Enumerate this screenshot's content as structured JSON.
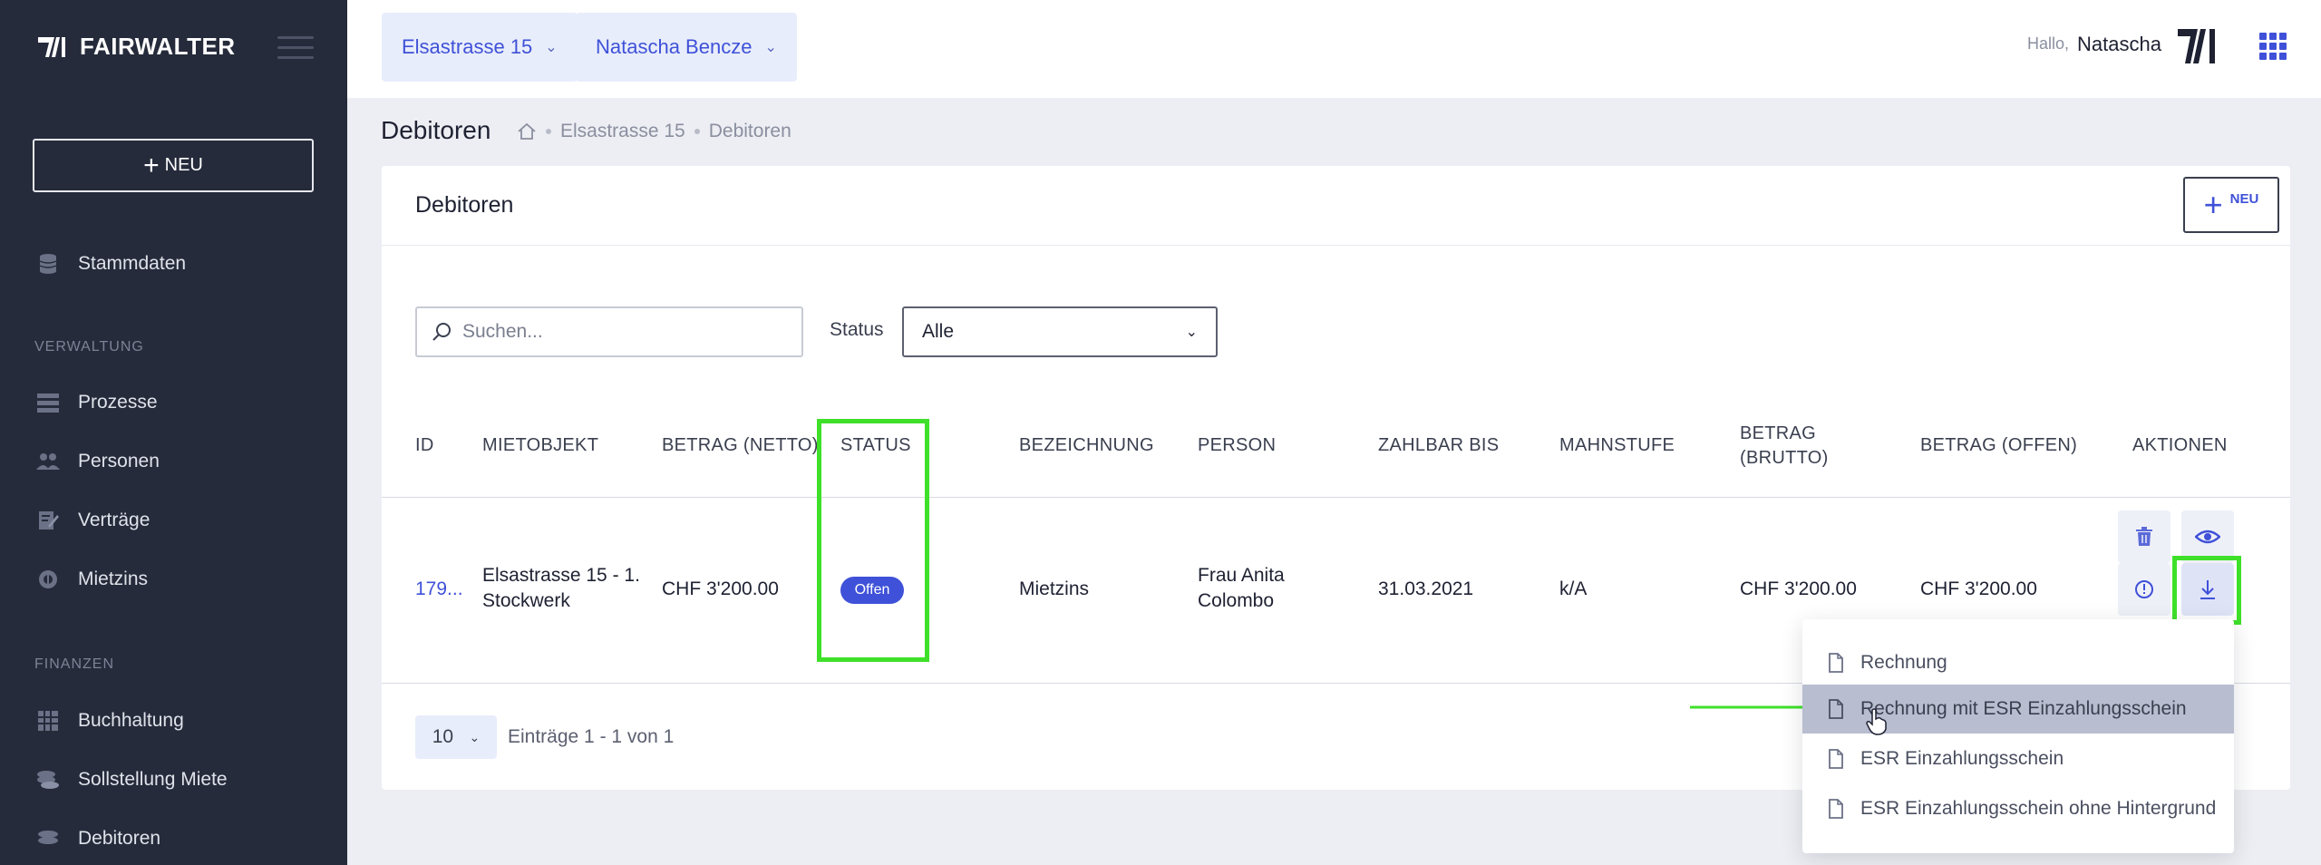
{
  "brand": "FAIRWALTER",
  "sidebar": {
    "new_label": "NEU",
    "items_top": [
      {
        "label": "Stammdaten",
        "icon": "database-icon"
      }
    ],
    "section_verwaltung": "VERWALTUNG",
    "items_verwaltung": [
      {
        "label": "Prozesse",
        "icon": "list-icon"
      },
      {
        "label": "Personen",
        "icon": "people-icon"
      },
      {
        "label": "Verträge",
        "icon": "contract-icon"
      },
      {
        "label": "Mietzins",
        "icon": "rent-icon"
      }
    ],
    "section_finanzen": "FINANZEN",
    "items_finanzen": [
      {
        "label": "Buchhaltung",
        "icon": "ledger-icon"
      },
      {
        "label": "Sollstellung Miete",
        "icon": "coins-icon"
      },
      {
        "label": "Debitoren",
        "icon": "debtor-icon"
      }
    ]
  },
  "topbar": {
    "property": "Elsastrasse 15",
    "person": "Natascha Bencze",
    "hello": "Hallo,",
    "user_name": "Natascha"
  },
  "page": {
    "title": "Debitoren",
    "breadcrumb": [
      "Elsastrasse 15",
      "Debitoren"
    ]
  },
  "card": {
    "title": "Debitoren",
    "new_label": "NEU",
    "search_placeholder": "Suchen...",
    "status_label": "Status",
    "status_value": "Alle"
  },
  "table": {
    "headers": {
      "id": "ID",
      "mietobjekt": "MIETOBJEKT",
      "betrag_netto": "BETRAG (NETTO)",
      "status": "STATUS",
      "bezeichnung": "BEZEICHNUNG",
      "person": "PERSON",
      "zahlbar_bis": "ZAHLBAR BIS",
      "mahnstufe": "MAHNSTUFE",
      "betrag_brutto_1": "BETRAG",
      "betrag_brutto_2": "(BRUTTO)",
      "betrag_offen": "BETRAG (OFFEN)",
      "aktionen": "AKTIONEN"
    },
    "rows": [
      {
        "id": "179...",
        "mietobjekt_1": "Elsastrasse 15 - 1.",
        "mietobjekt_2": "Stockwerk",
        "betrag_netto": "CHF 3'200.00",
        "status": "Offen",
        "bezeichnung": "Mietzins",
        "person_1": "Frau Anita",
        "person_2": "Colombo",
        "zahlbar_bis": "31.03.2021",
        "mahnstufe": "k/A",
        "betrag_brutto": "CHF 3'200.00",
        "betrag_offen": "CHF 3'200.00"
      }
    ]
  },
  "pagination": {
    "page_size": "10",
    "info": "Einträge 1 - 1 von 1"
  },
  "download_menu": [
    {
      "label": "Rechnung",
      "active": false
    },
    {
      "label": "Rechnung mit ESR Einzahlungsschein",
      "active": true
    },
    {
      "label": "ESR Einzahlungsschein",
      "active": false
    },
    {
      "label": "ESR Einzahlungsschein ohne Hintergrund",
      "active": false
    }
  ],
  "colors": {
    "accent": "#3f51d8",
    "sidebar": "#262b3b",
    "highlight": "#3fe02a"
  }
}
